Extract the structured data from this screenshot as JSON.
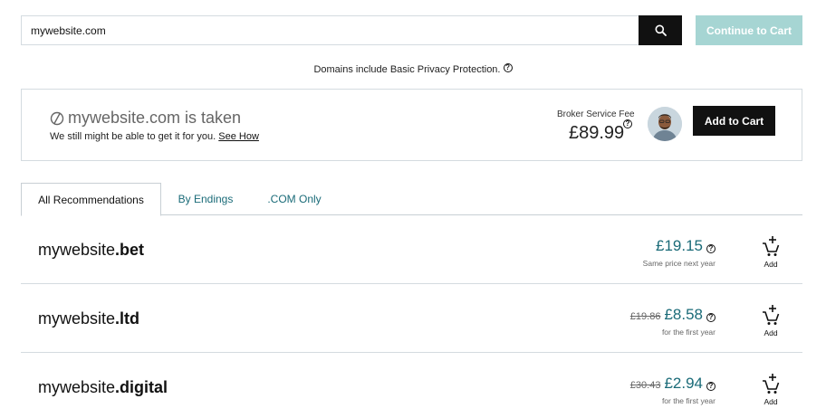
{
  "search": {
    "value": "mywebsite.com",
    "icon": "search-icon",
    "continue_label": "Continue to Cart"
  },
  "privacy_note": "Domains include Basic Privacy Protection.",
  "help_glyph": "?",
  "taken": {
    "title": "mywebsite.com is taken",
    "subtitle": "We still might be able to get it for you.",
    "see_how": "See How",
    "broker_label": "Broker Service Fee",
    "broker_price": "£89.99",
    "add_to_cart": "Add to Cart"
  },
  "tabs": [
    {
      "label": "All Recommendations",
      "active": true
    },
    {
      "label": "By Endings",
      "active": false
    },
    {
      "label": ".COM Only",
      "active": false
    }
  ],
  "results": [
    {
      "name": "mywebsite",
      "tld": ".bet",
      "old_price": "",
      "price": "£19.15",
      "note": "Same price next year",
      "add_label": "Add"
    },
    {
      "name": "mywebsite",
      "tld": ".ltd",
      "old_price": "£19.86",
      "price": "£8.58",
      "note": "for the first year",
      "add_label": "Add"
    },
    {
      "name": "mywebsite",
      "tld": ".digital",
      "old_price": "£30.43",
      "price": "£2.94",
      "note": "for the first year",
      "add_label": "Add"
    }
  ],
  "colors": {
    "accent_teal": "#1a6b78",
    "continue_disabled": "#a6d5d3",
    "primary_black": "#111111",
    "border": "#d4dbe0"
  }
}
